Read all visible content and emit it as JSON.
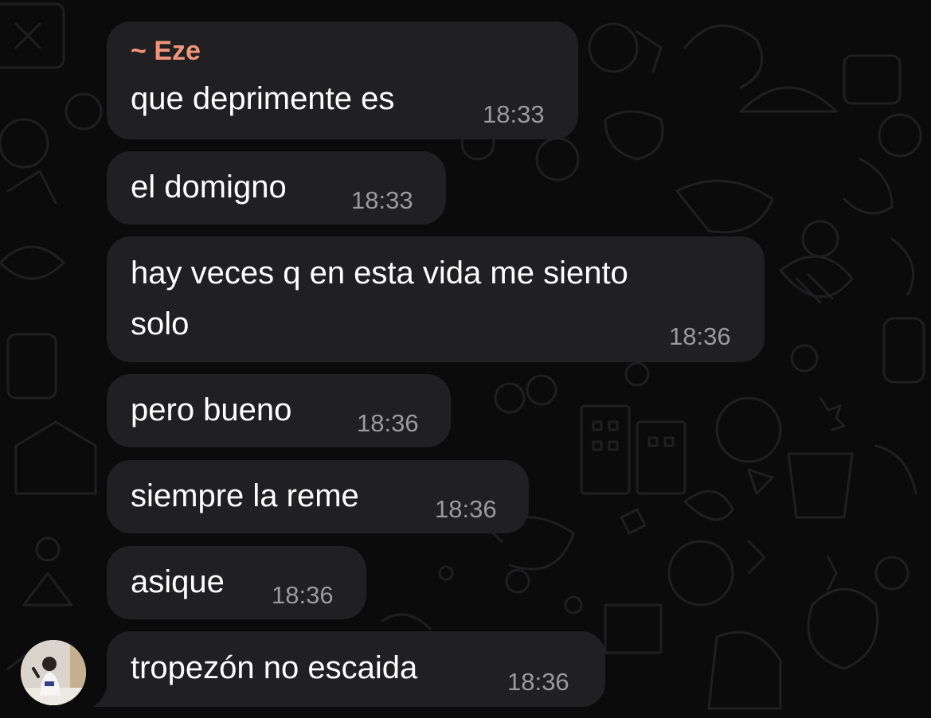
{
  "chat": {
    "sender_name": "Eze",
    "messages": [
      {
        "text": "que deprimente es",
        "time": "18:33"
      },
      {
        "text": "el domigno",
        "time": "18:33"
      },
      {
        "text": "hay veces q en esta vida me siento",
        "text_line2": "solo",
        "time": "18:36"
      },
      {
        "text": "pero bueno",
        "time": "18:36"
      },
      {
        "text": "siempre la reme",
        "time": "18:36"
      },
      {
        "text": "asique",
        "time": "18:36"
      },
      {
        "text": "tropezón no escaida",
        "time": "18:36"
      }
    ]
  },
  "theme": {
    "background": "#0b0b0b",
    "bubble": "#202022",
    "sender_color": "#f0947a",
    "text": "#ffffff",
    "time": "#9a9a9d"
  },
  "icons": [
    "doodle-wallpaper",
    "avatar-photo"
  ]
}
